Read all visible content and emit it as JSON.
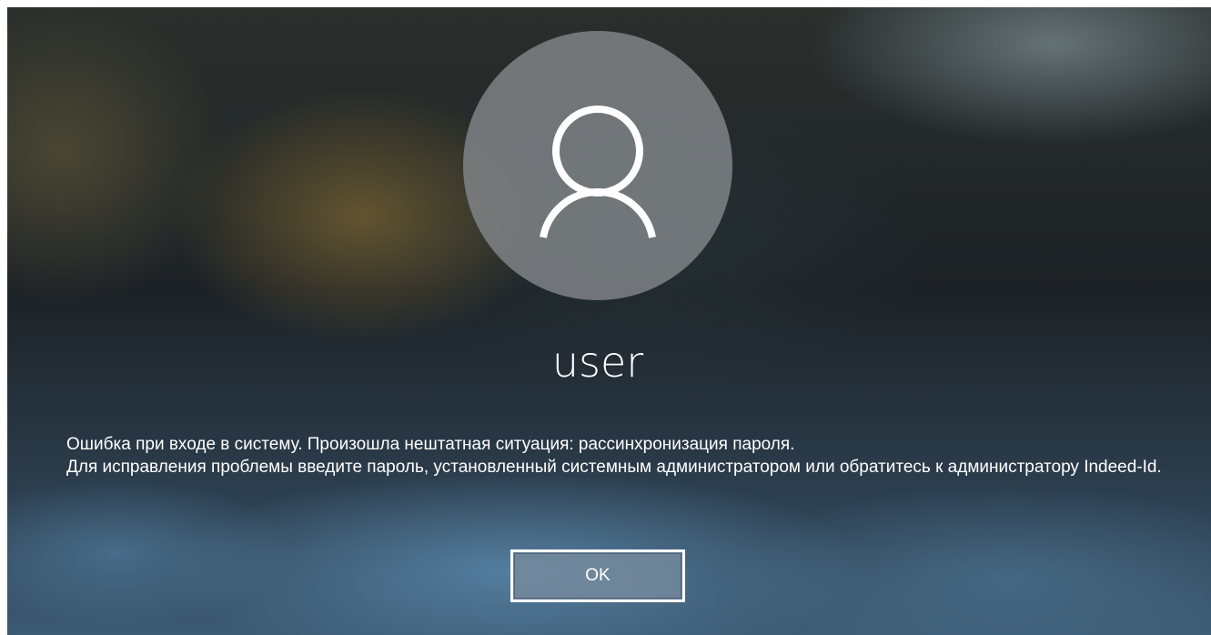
{
  "login": {
    "avatar_icon": "user-silhouette-icon",
    "username": "user",
    "message_lines": [
      "Ошибка при входе в систему. Произошла нештатная ситуация: рассинхронизация пароля.",
      "Для исправления проблемы введите пароль, установленный системным администратором или обратитесь к администратору Indeed-Id."
    ],
    "ok_label": "OK"
  },
  "colors": {
    "text": "#ffffff",
    "avatar_circle": "#82868a",
    "button_fill": "#788c9e",
    "button_border": "#ffffff"
  }
}
